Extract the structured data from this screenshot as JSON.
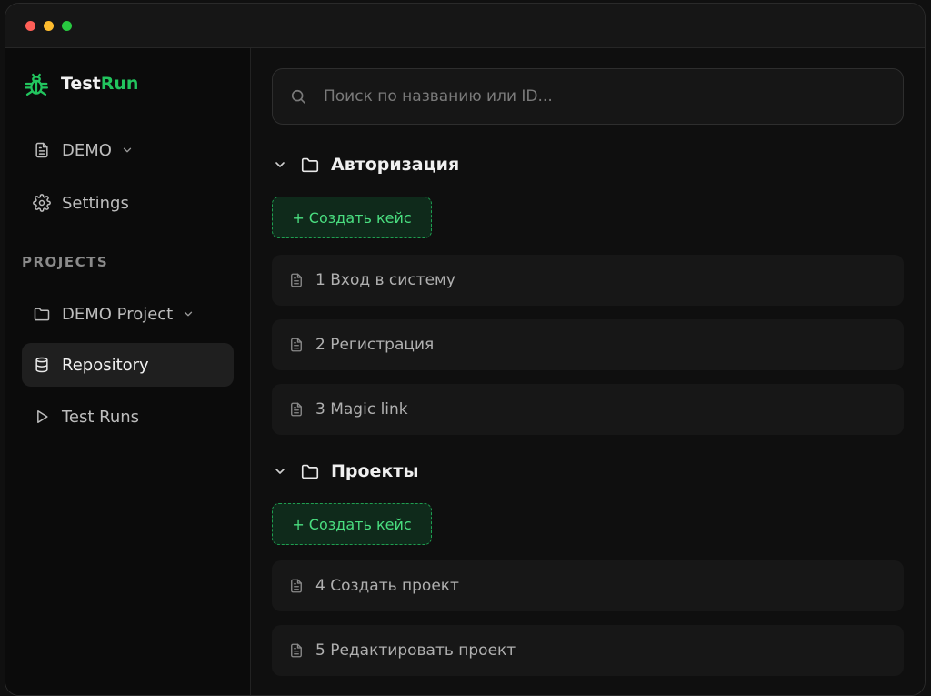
{
  "window": {
    "accent_color": "#22c55e"
  },
  "sidebar": {
    "brand": {
      "part1": "Test",
      "part2": "Run"
    },
    "workspace": {
      "label": "DEMO"
    },
    "settings": {
      "label": "Settings"
    },
    "section_title": "PROJECTS",
    "project": {
      "label": "DEMO Project"
    },
    "items": [
      {
        "label": "Repository",
        "active": true
      },
      {
        "label": "Test Runs",
        "active": false
      }
    ]
  },
  "search": {
    "placeholder": "Поиск по названию или ID..."
  },
  "folders": [
    {
      "name": "Авторизация",
      "create_label": "+ Создать кейс",
      "cases": [
        {
          "label": "1 Вход в систему"
        },
        {
          "label": "2 Регистрация"
        },
        {
          "label": "3 Magic link"
        }
      ]
    },
    {
      "name": "Проекты",
      "create_label": "+ Создать кейс",
      "cases": [
        {
          "label": "4 Создать проект"
        },
        {
          "label": "5 Редактировать проект"
        }
      ]
    }
  ]
}
